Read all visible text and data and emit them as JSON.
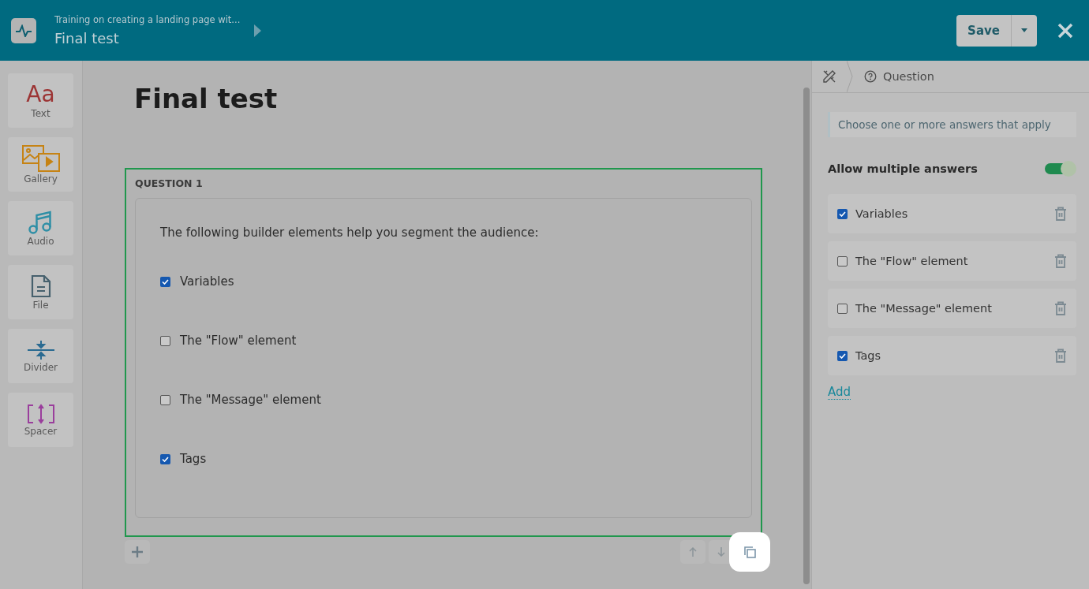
{
  "header": {
    "breadcrumb": "Training on creating a landing page wit...",
    "title": "Final test",
    "save": "Save"
  },
  "tools": [
    {
      "label": "Text",
      "kind": "text",
      "glyph": "Aa"
    },
    {
      "label": "Gallery",
      "kind": "gallery"
    },
    {
      "label": "Audio",
      "kind": "audio"
    },
    {
      "label": "File",
      "kind": "file"
    },
    {
      "label": "Divider",
      "kind": "divider"
    },
    {
      "label": "Spacer",
      "kind": "spacer"
    }
  ],
  "page_title": "Final test",
  "question": {
    "label": "QUESTION 1",
    "text": "The following builder elements help you segment the audience:",
    "options": [
      {
        "label": "Variables",
        "checked": true
      },
      {
        "label": "The \"Flow\" element",
        "checked": false
      },
      {
        "label": "The \"Message\" element",
        "checked": false
      },
      {
        "label": "Tags",
        "checked": true
      }
    ]
  },
  "block_actions": [
    {
      "kind": "add",
      "highlighted": false
    },
    {
      "kind": "up",
      "highlighted": false
    },
    {
      "kind": "down",
      "highlighted": false
    },
    {
      "kind": "copy",
      "highlighted": true
    }
  ],
  "panel": {
    "breadcrumb": "Question",
    "description": "Choose one or more answers that apply",
    "toggle": {
      "label": "Allow multiple answers",
      "on": true
    },
    "answers": [
      {
        "label": "Variables",
        "checked": true
      },
      {
        "label": "The \"Flow\" element",
        "checked": false
      },
      {
        "label": "The \"Message\" element",
        "checked": false
      },
      {
        "label": "Tags",
        "checked": true
      }
    ],
    "add": "Add"
  }
}
